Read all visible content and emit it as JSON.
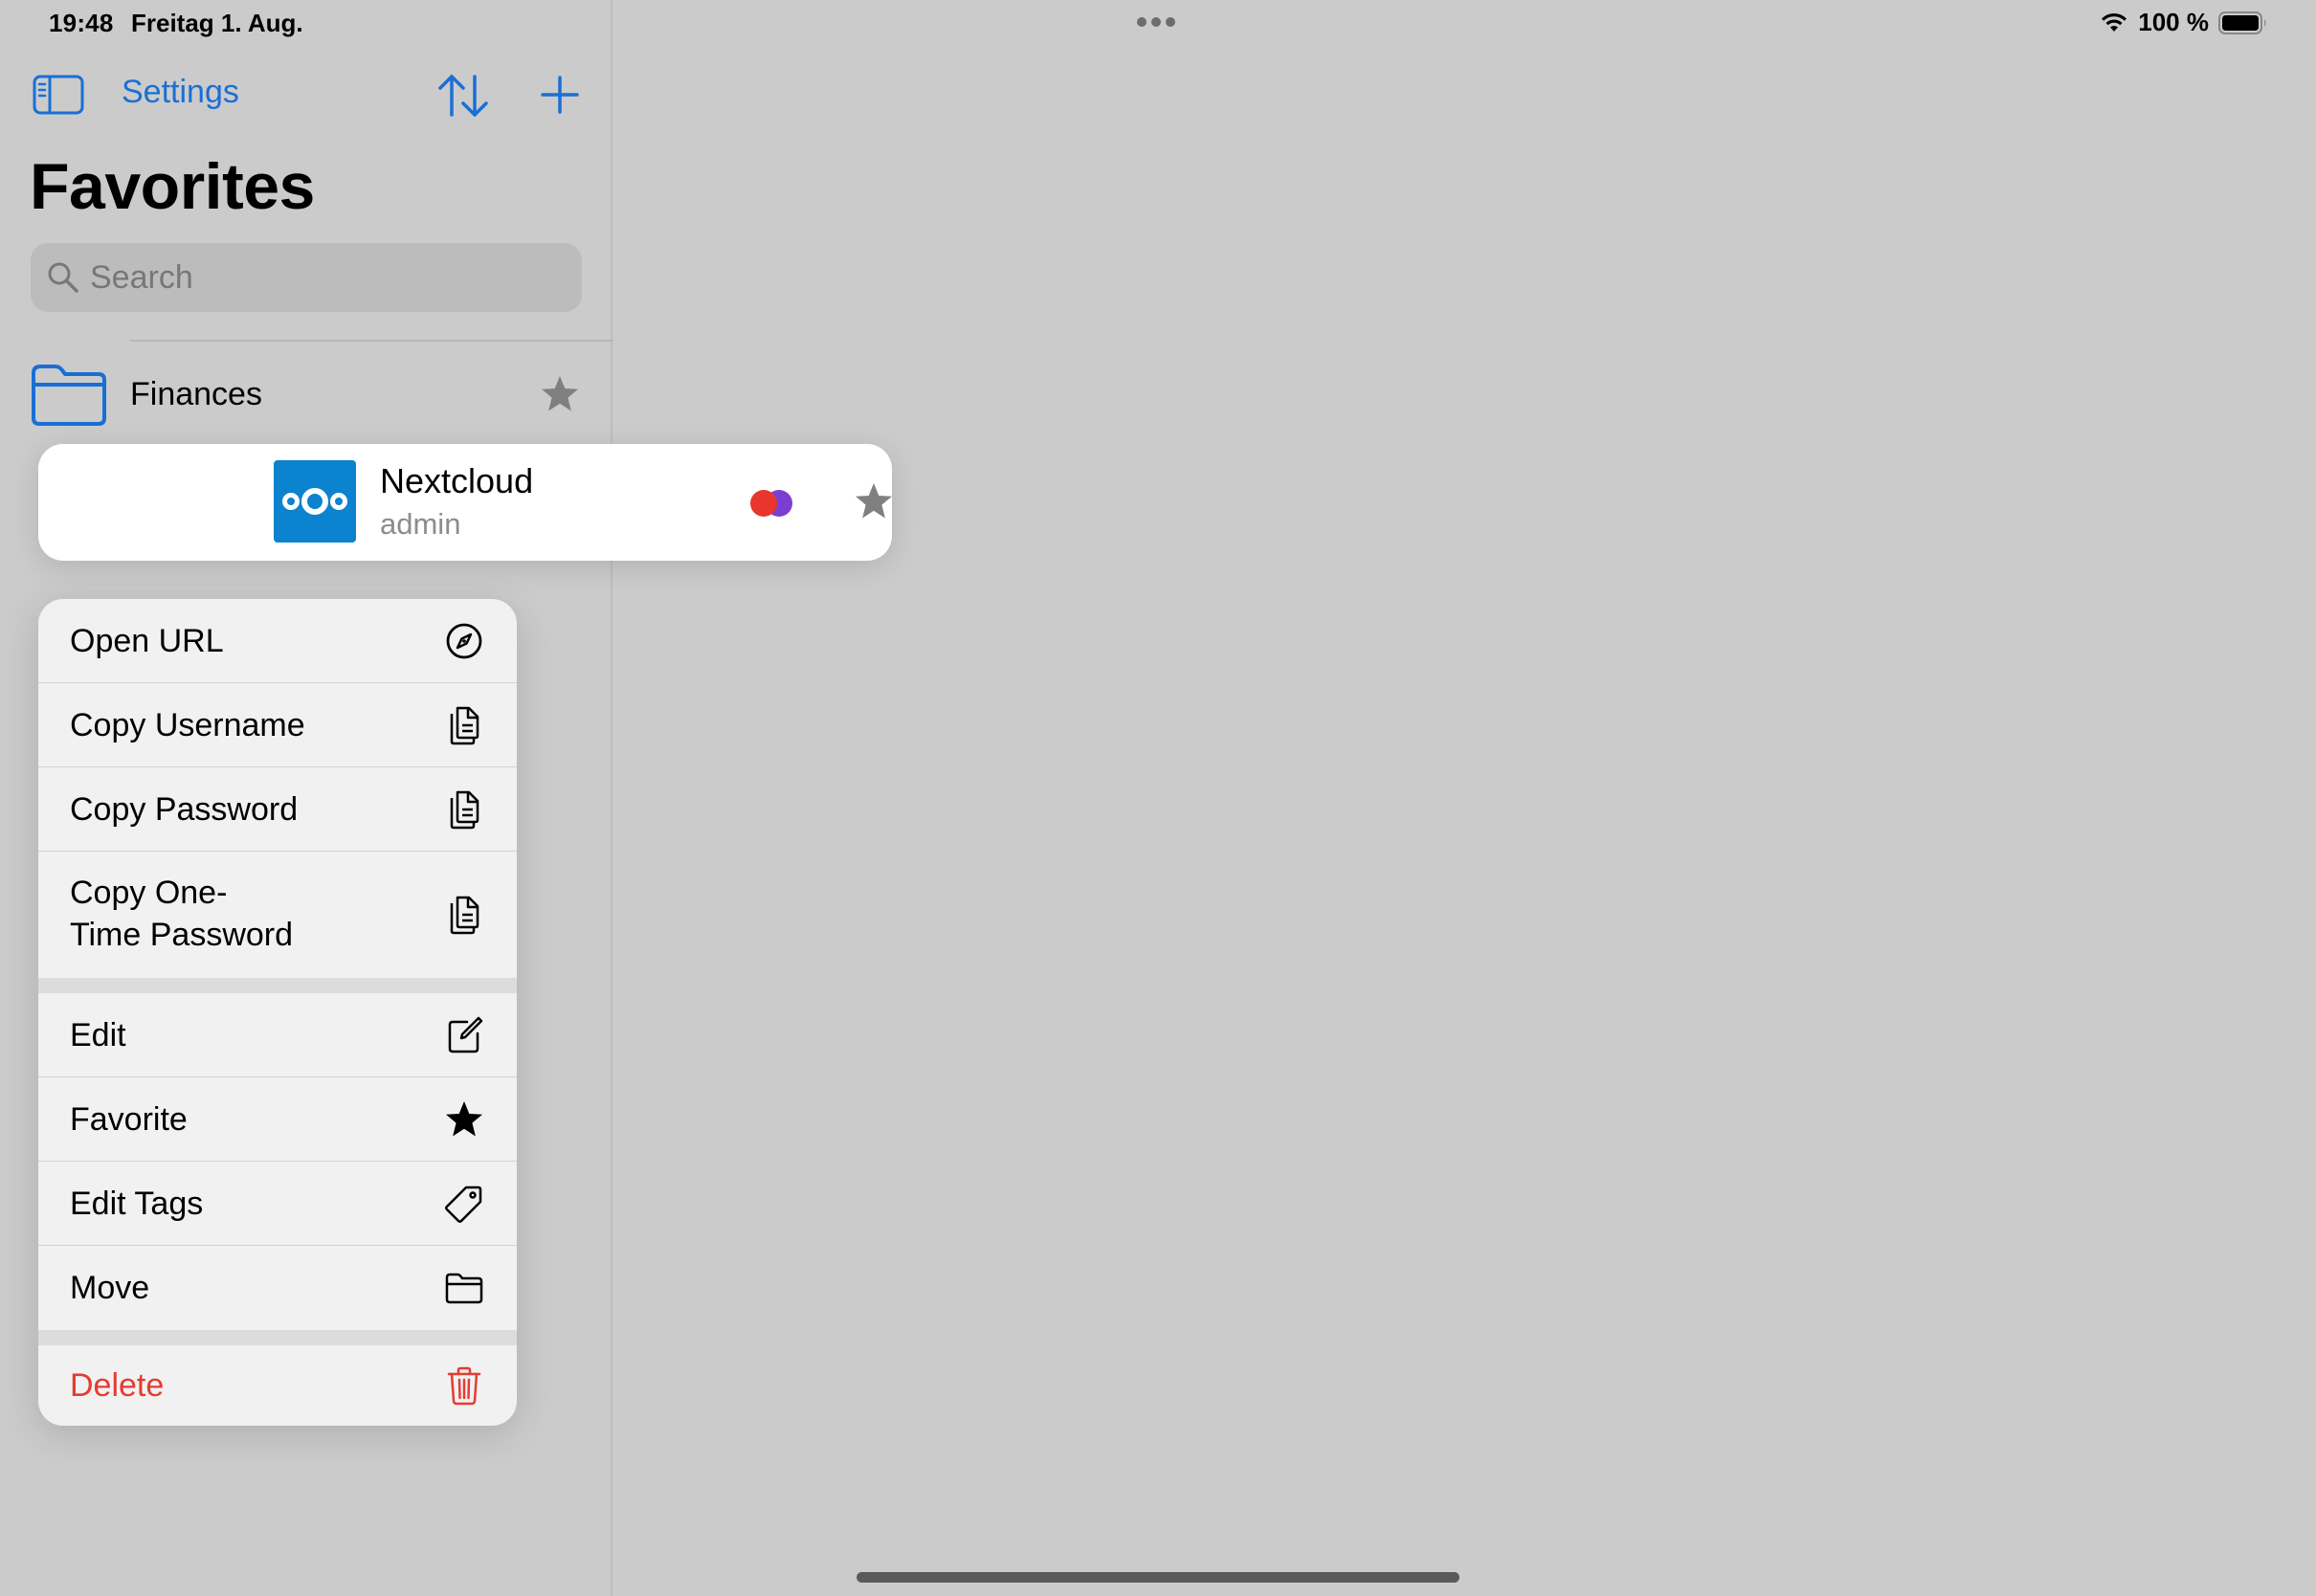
{
  "status_bar": {
    "time": "19:48",
    "date": "Freitag 1. Aug.",
    "battery": "100 %"
  },
  "sidebar": {
    "settings_label": "Settings",
    "title": "Favorites",
    "search_placeholder": "Search",
    "folders": [
      {
        "label": "Finances",
        "favorite": true
      }
    ]
  },
  "preview": {
    "title": "Nextcloud",
    "username": "admin",
    "tag_colors": [
      "#e8362d",
      "#7a3fd0"
    ],
    "accent": "#0b83ce"
  },
  "menu": {
    "open_url": "Open URL",
    "copy_username": "Copy Username",
    "copy_password": "Copy Password",
    "copy_otp": "Copy One-\nTime Password",
    "edit": "Edit",
    "favorite": "Favorite",
    "edit_tags": "Edit Tags",
    "move": "Move",
    "delete": "Delete"
  },
  "colors": {
    "accent": "#1a6fd4",
    "destructive": "#e53b30"
  }
}
